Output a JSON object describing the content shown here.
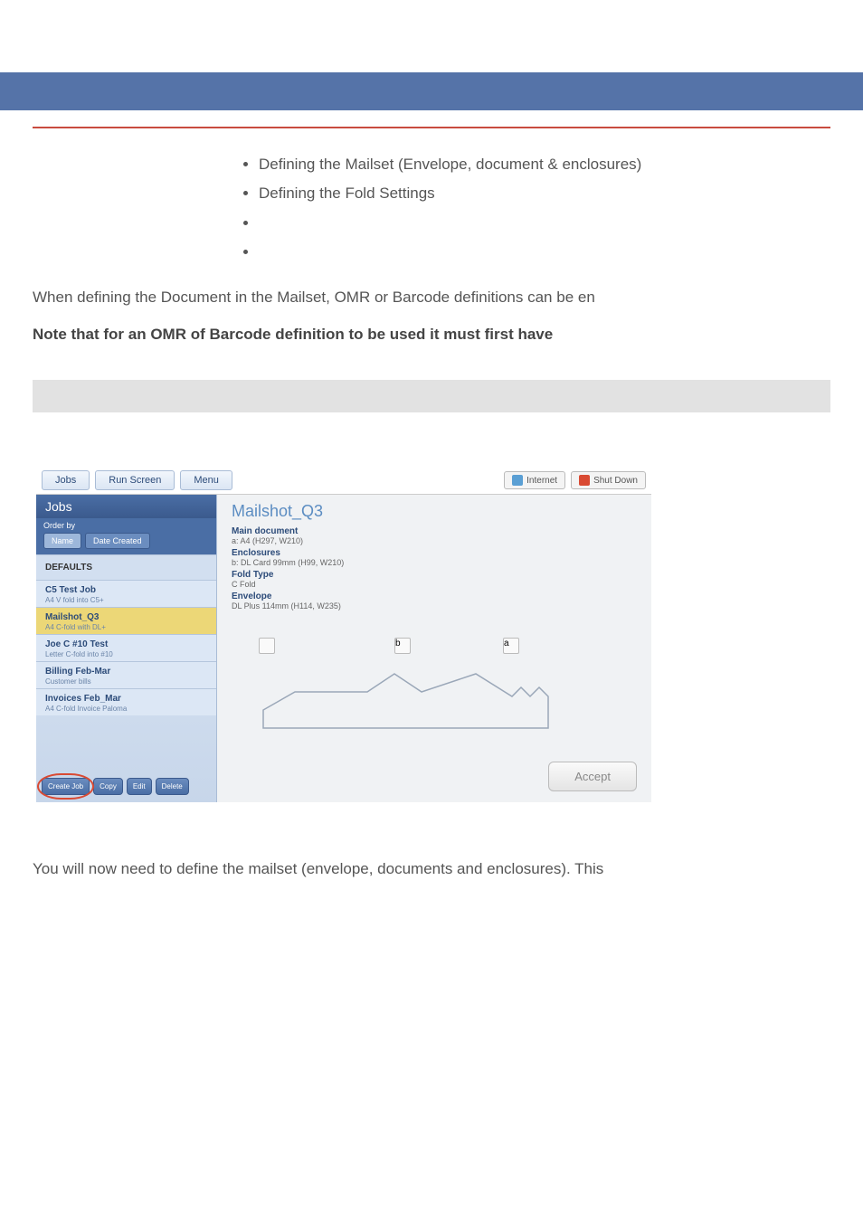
{
  "bullets": [
    "Defining the Mailset (Envelope, document & enclosures)",
    "Defining the Fold Settings",
    "",
    ""
  ],
  "para1": "When defining the Document in the Mailset, OMR or Barcode definitions can be en",
  "boldNote": "Note that for an OMR of Barcode definition to be used it must first have",
  "topbar": {
    "jobs": "Jobs",
    "runScreen": "Run Screen",
    "menu": "Menu",
    "internet": "Internet",
    "shutdown": "Shut Down"
  },
  "sidebar": {
    "header": "Jobs",
    "orderby": "Order by",
    "name": "Name",
    "dateCreated": "Date Created",
    "defaults": "DEFAULTS",
    "items": [
      {
        "name": "C5 Test Job",
        "sub": "A4 V fold into C5+"
      },
      {
        "name": "Mailshot_Q3",
        "sub": "A4 C-fold with DL+"
      },
      {
        "name": "Joe C #10 Test",
        "sub": "Letter C-fold into #10"
      },
      {
        "name": "Billing Feb-Mar",
        "sub": "Customer bills"
      },
      {
        "name": "Invoices Feb_Mar",
        "sub": "A4 C-fold Invoice Paloma"
      }
    ],
    "footer": {
      "create": "Create Job",
      "copy": "Copy",
      "edit": "Edit",
      "delete": "Delete"
    }
  },
  "main": {
    "title": "Mailshot_Q3",
    "details": [
      {
        "label": "Main document",
        "value": "a: A4 (H297, W210)"
      },
      {
        "label": "Enclosures",
        "value": "b: DL Card 99mm (H99, W210)"
      },
      {
        "label": "Fold Type",
        "value": "C Fold"
      },
      {
        "label": "Envelope",
        "value": "DL Plus 114mm (H114, W235)"
      }
    ],
    "accept": "Accept"
  },
  "bottomPara": "You will now need to define the mailset (envelope, documents and enclosures). This"
}
